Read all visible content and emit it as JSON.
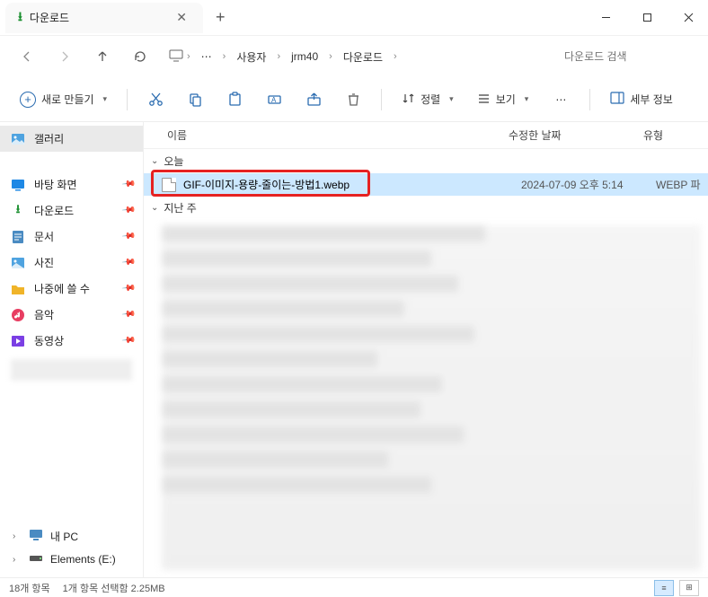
{
  "titlebar": {
    "tab_title": "다운로드",
    "tab_icon": "download-icon"
  },
  "nav": {
    "breadcrumb": [
      "사용자",
      "jrm40",
      "다운로드"
    ],
    "search_placeholder": "다운로드 검색"
  },
  "toolbar": {
    "new_label": "새로 만들기",
    "sort_label": "정렬",
    "view_label": "보기",
    "details_label": "세부 정보"
  },
  "sidebar": {
    "gallery": "갤러리",
    "items": [
      {
        "icon": "desktop",
        "label": "바탕 화면",
        "pinned": true,
        "color": "#1e88e5"
      },
      {
        "icon": "download",
        "label": "다운로드",
        "pinned": true,
        "color": "#1a8f2f"
      },
      {
        "icon": "document",
        "label": "문서",
        "pinned": true,
        "color": "#1e88e5"
      },
      {
        "icon": "picture",
        "label": "사진",
        "pinned": true,
        "color": "#1e88e5"
      },
      {
        "icon": "folder",
        "label": "나중에 쓸 수",
        "pinned": true,
        "color": "#f0b429"
      },
      {
        "icon": "music",
        "label": "음악",
        "pinned": true,
        "color": "#e83e62"
      },
      {
        "icon": "video",
        "label": "동영상",
        "pinned": true,
        "color": "#7b3fe4"
      }
    ],
    "tree": [
      {
        "label": "내 PC",
        "icon": "pc"
      },
      {
        "label": "Elements (E:)",
        "icon": "drive"
      }
    ]
  },
  "columns": {
    "name": "이름",
    "date": "수정한 날짜",
    "type": "유형"
  },
  "groups": [
    {
      "header": "오늘",
      "files": [
        {
          "name": "GIF-이미지-용량-줄이는-방법1.webp",
          "date": "2024-07-09 오후 5:14",
          "type": "WEBP 파",
          "selected": true,
          "highlighted": true
        }
      ]
    },
    {
      "header": "지난 주",
      "files": []
    }
  ],
  "status": {
    "items": "18개 항목",
    "selected": "1개 항목 선택함 2.25MB"
  }
}
